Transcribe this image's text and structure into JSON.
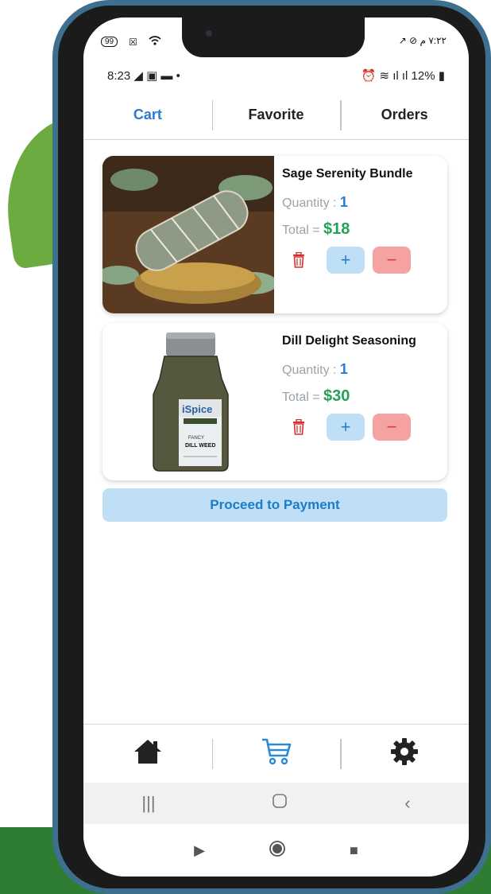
{
  "device": {
    "outer_status": {
      "badge": "99",
      "right_text": "٧:٢٢ م"
    },
    "status_bar": {
      "time": "8:23",
      "battery": "12%"
    }
  },
  "tabs": [
    {
      "label": "Cart",
      "active": true
    },
    {
      "label": "Favorite",
      "active": false
    },
    {
      "label": "Orders",
      "active": false
    }
  ],
  "cart": {
    "items": [
      {
        "name": "Sage Serenity Bundle",
        "quantity_label": "Quantity : ",
        "quantity": "1",
        "total_label": "Total = ",
        "total": "$18",
        "image": "sage-bundle-image"
      },
      {
        "name": "Dill Delight Seasoning",
        "quantity_label": "Quantity : ",
        "quantity": "1",
        "total_label": "Total = ",
        "total": "$30",
        "image": "dill-jar-image"
      }
    ],
    "plus_label": "+",
    "minus_label": "−",
    "pay_button": "Proceed to Payment"
  },
  "bottom_nav": [
    {
      "icon": "home-icon"
    },
    {
      "icon": "cart-icon",
      "active": true
    },
    {
      "icon": "gear-icon"
    }
  ],
  "colors": {
    "accent": "#2a7bd6",
    "price": "#24a05a",
    "plus_bg": "#bfdff6",
    "minus_bg": "#f4a2a2",
    "delete": "#d32f2f"
  }
}
